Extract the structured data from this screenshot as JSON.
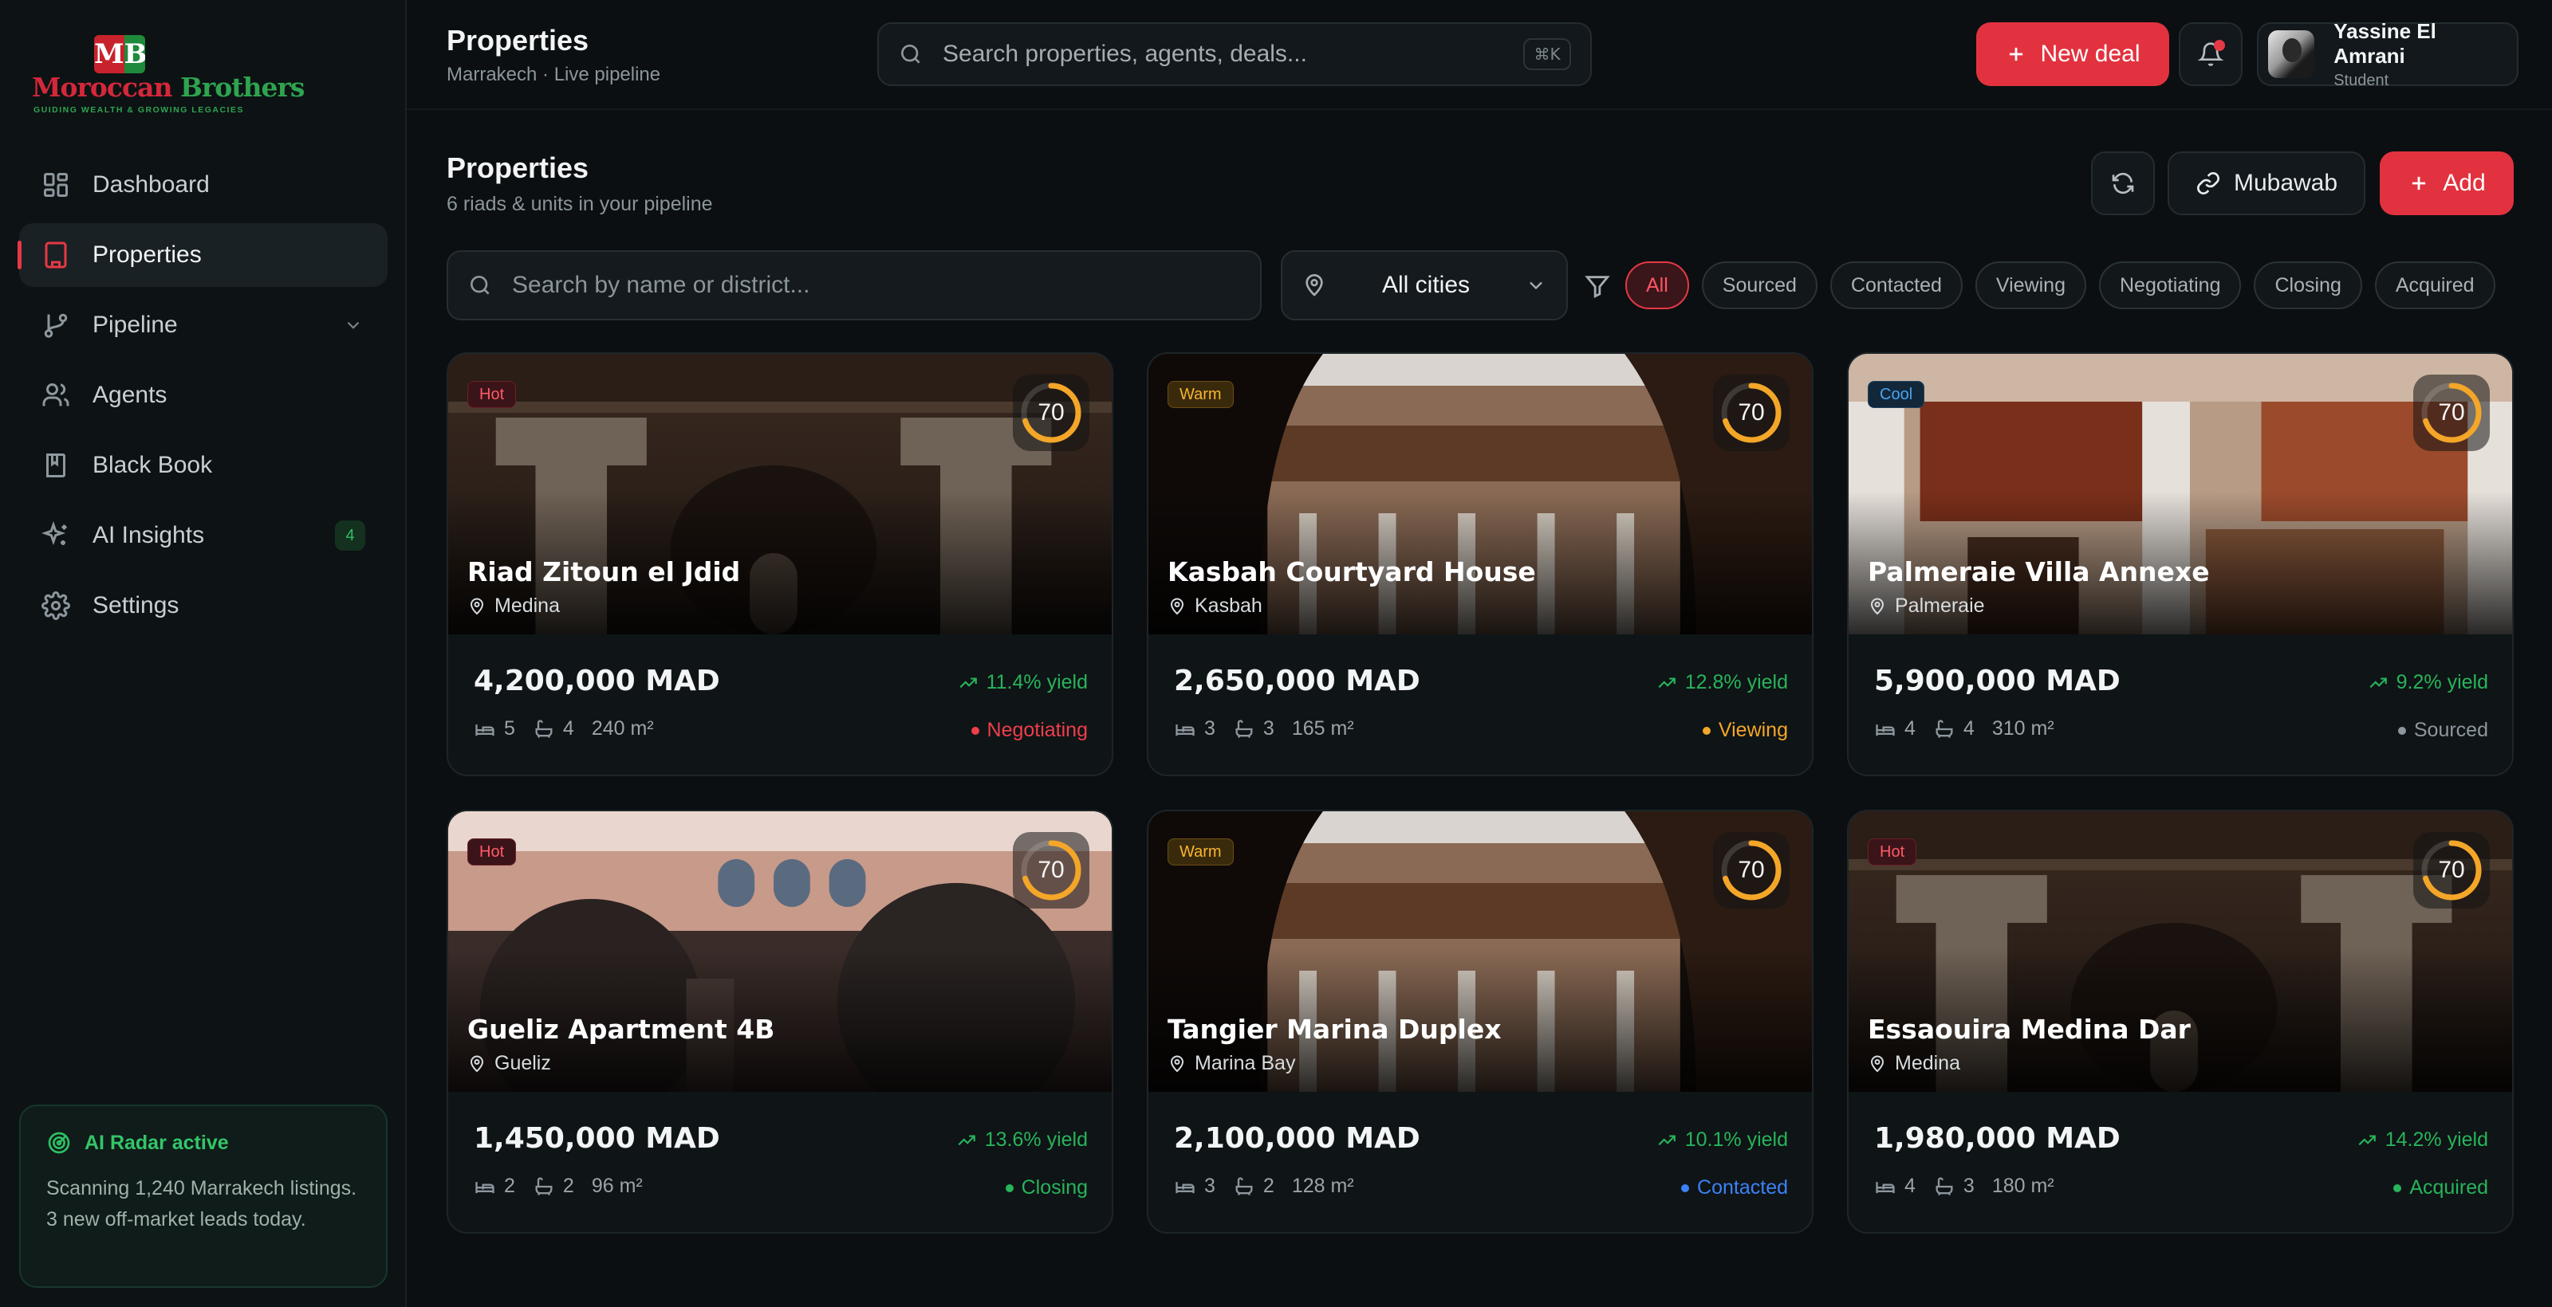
{
  "brand": {
    "name_red": "Moroccan ",
    "name_green": "Brothers",
    "tagline": "GUIDING WEALTH & GROWING LEGACIES",
    "mono_m": "M",
    "mono_b": "B"
  },
  "sidebar": {
    "items": [
      {
        "label": "Dashboard",
        "icon": "dashboard-icon"
      },
      {
        "label": "Properties",
        "icon": "building-icon",
        "active": true
      },
      {
        "label": "Pipeline",
        "icon": "git-branch-icon"
      },
      {
        "label": "Agents",
        "icon": "users-icon"
      },
      {
        "label": "Black Book",
        "icon": "book-icon"
      },
      {
        "label": "AI Insights",
        "icon": "sparkles-icon",
        "badge": "4"
      },
      {
        "label": "Settings",
        "icon": "gear-icon"
      }
    ],
    "radar": {
      "title": "AI Radar active",
      "text": "Scanning 1,240 Marrakech listings. 3 new off-market leads today."
    }
  },
  "topbar": {
    "title": "Properties",
    "subtitle": "Marrakech · Live pipeline",
    "search_placeholder": "Search properties, agents, deals...",
    "shortcut": "⌘K",
    "new_deal": "New deal",
    "user": {
      "name": "Yassine El Amrani",
      "role": "Student"
    }
  },
  "page": {
    "title": "Properties",
    "subtitle": "6 riads & units in your pipeline",
    "mubawab": "Mubawab",
    "add": "Add",
    "search_placeholder": "Search by name or district...",
    "city": "All cities",
    "filters": [
      "All",
      "Sourced",
      "Contacted",
      "Viewing",
      "Negotiating",
      "Closing",
      "Acquired"
    ],
    "active_filter": "All"
  },
  "properties": [
    {
      "name": "Riad Zitoun el Jdid",
      "location": "Medina",
      "tag": "Hot",
      "score": "70",
      "score_value": 0.7,
      "price": "4,200,000 MAD",
      "yield": "11.4% yield",
      "beds": "5",
      "baths": "4",
      "area": "240 m²",
      "status": "Negotiating",
      "status_color": "#ef3e4c",
      "scene": "dark"
    },
    {
      "name": "Kasbah Courtyard House",
      "location": "Kasbah",
      "tag": "Warm",
      "score": "70",
      "score_value": 0.7,
      "price": "2,650,000 MAD",
      "yield": "12.8% yield",
      "beds": "3",
      "baths": "3",
      "area": "165 m²",
      "status": "Viewing",
      "status_color": "#f4a628",
      "scene": "arch"
    },
    {
      "name": "Palmeraie Villa Annexe",
      "location": "Palmeraie",
      "tag": "Cool",
      "score": "70",
      "score_value": 0.7,
      "price": "5,900,000 MAD",
      "yield": "9.2% yield",
      "beds": "4",
      "baths": "4",
      "area": "310 m²",
      "status": "Sourced",
      "status_color": "#8d979e",
      "scene": "wall"
    },
    {
      "name": "Gueliz Apartment 4B",
      "location": "Gueliz",
      "tag": "Hot",
      "score": "70",
      "score_value": 0.7,
      "price": "1,450,000 MAD",
      "yield": "13.6% yield",
      "beds": "2",
      "baths": "2",
      "area": "96 m²",
      "status": "Closing",
      "status_color": "#27b45b",
      "scene": "pink"
    },
    {
      "name": "Tangier Marina Duplex",
      "location": "Marina Bay",
      "tag": "Warm",
      "score": "70",
      "score_value": 0.7,
      "price": "2,100,000 MAD",
      "yield": "10.1% yield",
      "beds": "3",
      "baths": "2",
      "area": "128 m²",
      "status": "Contacted",
      "status_color": "#3b82f6",
      "scene": "arch"
    },
    {
      "name": "Essaouira Medina Dar",
      "location": "Medina",
      "tag": "Hot",
      "score": "70",
      "score_value": 0.7,
      "price": "1,980,000 MAD",
      "yield": "14.2% yield",
      "beds": "4",
      "baths": "3",
      "area": "180 m²",
      "status": "Acquired",
      "status_color": "#27b45b",
      "scene": "dark"
    }
  ],
  "colors": {
    "accent": "#e2323f",
    "green": "#27b45b",
    "score_ring": "#f4a628"
  }
}
